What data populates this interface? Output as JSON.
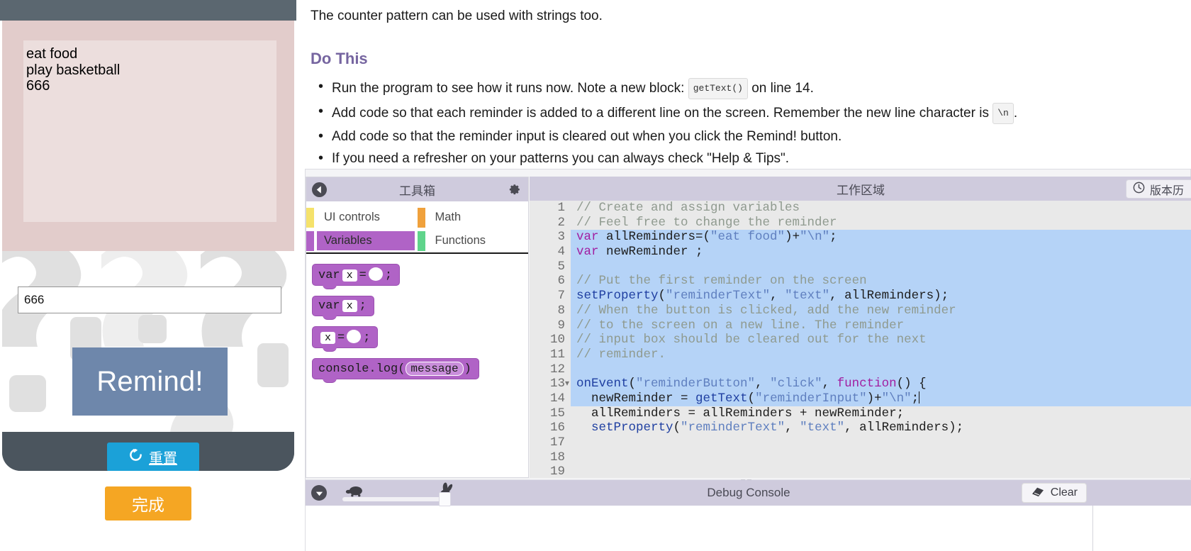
{
  "app_preview": {
    "reminder_text_lines": "eat food\nplay basketball\n666",
    "reminder_input_value": "666",
    "reminder_input_placeholder": "",
    "remind_button_label": "Remind!",
    "reset_button_label": "重置",
    "finish_button_label": "完成"
  },
  "instructions": {
    "intro": "The counter pattern can be used with strings too.",
    "heading": "Do This",
    "bullets": [
      {
        "pre": "Run the program to see how it runs now. Note a new block:",
        "code": "getText()",
        "post": "on line 14."
      },
      {
        "pre": "Add code so that each reminder is added to a different line on the screen. Remember the new line character is",
        "code": "\\n",
        "post": "."
      },
      {
        "pre": "Add code so that the reminder input is cleared out when you click the Remind! button.",
        "code": "",
        "post": ""
      },
      {
        "pre": "If you need a refresher on your patterns you can always check \"Help & Tips\".",
        "code": "",
        "post": ""
      }
    ]
  },
  "toolbox": {
    "title": "工具箱",
    "back_icon": "back-arrow-icon",
    "gear_icon": "gear-icon",
    "categories": [
      {
        "label": "UI controls",
        "color": "#f5e26b",
        "selected": false
      },
      {
        "label": "Math",
        "color": "#f0a13c",
        "selected": false
      },
      {
        "label": "Variables",
        "color": "#b063c6",
        "selected": true
      },
      {
        "label": "Functions",
        "color": "#5fd48b",
        "selected": false
      }
    ],
    "blocks": [
      {
        "id": "var-assign",
        "parts": [
          {
            "t": "text",
            "v": "var"
          },
          {
            "t": "slot-x",
            "v": "x"
          },
          {
            "t": "text",
            "v": "="
          },
          {
            "t": "oval",
            "v": ""
          },
          {
            "t": "text",
            "v": ";"
          }
        ]
      },
      {
        "id": "var-declare",
        "parts": [
          {
            "t": "text",
            "v": "var"
          },
          {
            "t": "slot-x",
            "v": "x"
          },
          {
            "t": "text",
            "v": ";"
          }
        ]
      },
      {
        "id": "assign",
        "parts": [
          {
            "t": "slot-x",
            "v": "x"
          },
          {
            "t": "text",
            "v": "="
          },
          {
            "t": "oval",
            "v": ""
          },
          {
            "t": "text",
            "v": ";"
          }
        ]
      },
      {
        "id": "console-log",
        "parts": [
          {
            "t": "text",
            "v": "console.log("
          },
          {
            "t": "msg",
            "v": "message"
          },
          {
            "t": "text",
            "v": ")"
          }
        ]
      }
    ]
  },
  "editor": {
    "title": "工作区域",
    "version_history_label": "版本历",
    "version_icon": "clock-icon",
    "code_lines": [
      {
        "n": "1",
        "fold": false,
        "selected": false,
        "current": false,
        "tokens": [
          {
            "c": "tok-comment",
            "t": "// Create and assign variables"
          }
        ]
      },
      {
        "n": "2",
        "fold": false,
        "selected": false,
        "current": false,
        "tokens": [
          {
            "c": "tok-comment",
            "t": "// Feel free to change the reminder"
          }
        ]
      },
      {
        "n": "3",
        "fold": false,
        "selected": true,
        "current": false,
        "tokens": [
          {
            "c": "tok-kw",
            "t": "var"
          },
          {
            "c": "tok-plain",
            "t": " allReminders=("
          },
          {
            "c": "tok-str",
            "t": "\"eat food\""
          },
          {
            "c": "tok-plain",
            "t": ")+"
          },
          {
            "c": "tok-str",
            "t": "\"\\n\""
          },
          {
            "c": "tok-plain",
            "t": ";"
          }
        ]
      },
      {
        "n": "4",
        "fold": false,
        "selected": true,
        "current": false,
        "tokens": [
          {
            "c": "tok-kw",
            "t": "var"
          },
          {
            "c": "tok-plain",
            "t": " newReminder ;"
          }
        ]
      },
      {
        "n": "5",
        "fold": false,
        "selected": true,
        "current": false,
        "tokens": [
          {
            "c": "tok-plain",
            "t": ""
          }
        ]
      },
      {
        "n": "6",
        "fold": false,
        "selected": true,
        "current": false,
        "tokens": [
          {
            "c": "tok-comment",
            "t": "// Put the first reminder on the screen"
          }
        ]
      },
      {
        "n": "7",
        "fold": false,
        "selected": true,
        "current": false,
        "tokens": [
          {
            "c": "tok-fn",
            "t": "setProperty"
          },
          {
            "c": "tok-plain",
            "t": "("
          },
          {
            "c": "tok-str",
            "t": "\"reminderText\""
          },
          {
            "c": "tok-plain",
            "t": ", "
          },
          {
            "c": "tok-str",
            "t": "\"text\""
          },
          {
            "c": "tok-plain",
            "t": ", allReminders);"
          }
        ]
      },
      {
        "n": "8",
        "fold": false,
        "selected": true,
        "current": false,
        "tokens": [
          {
            "c": "tok-comment",
            "t": "// When the button is clicked, add the new reminder"
          }
        ]
      },
      {
        "n": "9",
        "fold": false,
        "selected": true,
        "current": false,
        "tokens": [
          {
            "c": "tok-comment",
            "t": "// to the screen on a new line. The reminder"
          }
        ]
      },
      {
        "n": "10",
        "fold": false,
        "selected": true,
        "current": false,
        "tokens": [
          {
            "c": "tok-comment",
            "t": "// input box should be cleared out for the next"
          }
        ]
      },
      {
        "n": "11",
        "fold": false,
        "selected": true,
        "current": false,
        "tokens": [
          {
            "c": "tok-comment",
            "t": "// reminder."
          }
        ]
      },
      {
        "n": "12",
        "fold": false,
        "selected": true,
        "current": false,
        "tokens": [
          {
            "c": "tok-plain",
            "t": ""
          }
        ]
      },
      {
        "n": "13",
        "fold": true,
        "selected": true,
        "current": false,
        "tokens": [
          {
            "c": "tok-fn",
            "t": "onEvent"
          },
          {
            "c": "tok-plain",
            "t": "("
          },
          {
            "c": "tok-str",
            "t": "\"reminderButton\""
          },
          {
            "c": "tok-plain",
            "t": ", "
          },
          {
            "c": "tok-str",
            "t": "\"click\""
          },
          {
            "c": "tok-plain",
            "t": ", "
          },
          {
            "c": "tok-kw",
            "t": "function"
          },
          {
            "c": "tok-plain",
            "t": "() {"
          }
        ]
      },
      {
        "n": "14",
        "fold": false,
        "selected": true,
        "current": true,
        "caret": true,
        "tokens": [
          {
            "c": "tok-plain",
            "t": "  newReminder = "
          },
          {
            "c": "tok-fn",
            "t": "getText"
          },
          {
            "c": "tok-plain",
            "t": "("
          },
          {
            "c": "tok-str",
            "t": "\"reminderInput\""
          },
          {
            "c": "tok-plain",
            "t": ")+"
          },
          {
            "c": "tok-str",
            "t": "\"\\n\""
          },
          {
            "c": "tok-plain",
            "t": ";"
          }
        ]
      },
      {
        "n": "15",
        "fold": false,
        "selected": false,
        "current": false,
        "tokens": [
          {
            "c": "tok-plain",
            "t": "  allReminders = allReminders + newReminder;"
          }
        ]
      },
      {
        "n": "16",
        "fold": false,
        "selected": false,
        "current": false,
        "tokens": [
          {
            "c": "tok-fn",
            "t": "  setProperty"
          },
          {
            "c": "tok-plain",
            "t": "("
          },
          {
            "c": "tok-str",
            "t": "\"reminderText\""
          },
          {
            "c": "tok-plain",
            "t": ", "
          },
          {
            "c": "tok-str",
            "t": "\"text\""
          },
          {
            "c": "tok-plain",
            "t": ", allReminders);"
          }
        ]
      },
      {
        "n": "17",
        "fold": false,
        "selected": false,
        "current": false,
        "tokens": [
          {
            "c": "tok-plain",
            "t": ""
          }
        ]
      },
      {
        "n": "18",
        "fold": false,
        "selected": false,
        "current": false,
        "tokens": [
          {
            "c": "tok-plain",
            "t": ""
          }
        ]
      },
      {
        "n": "19",
        "fold": false,
        "selected": false,
        "current": false,
        "tokens": [
          {
            "c": "tok-plain",
            "t": ""
          }
        ]
      }
    ]
  },
  "console": {
    "title": "Debug Console",
    "clear_label": "Clear",
    "clear_icon": "eraser-icon",
    "collapse_icon": "chevron-down-icon",
    "slow_icon": "turtle-icon",
    "fast_icon": "rabbit-icon",
    "output": ""
  },
  "colors": {
    "accent_purple": "#7665a0",
    "toolbar_lavender": "#cfcbdd",
    "selection_blue": "#b5d3f7",
    "block_purple": "#b063c6",
    "reset_blue": "#1ba1d8",
    "finish_orange": "#f5a623",
    "remind_blue": "#6e87ab",
    "phone_gray": "#5b6770"
  }
}
